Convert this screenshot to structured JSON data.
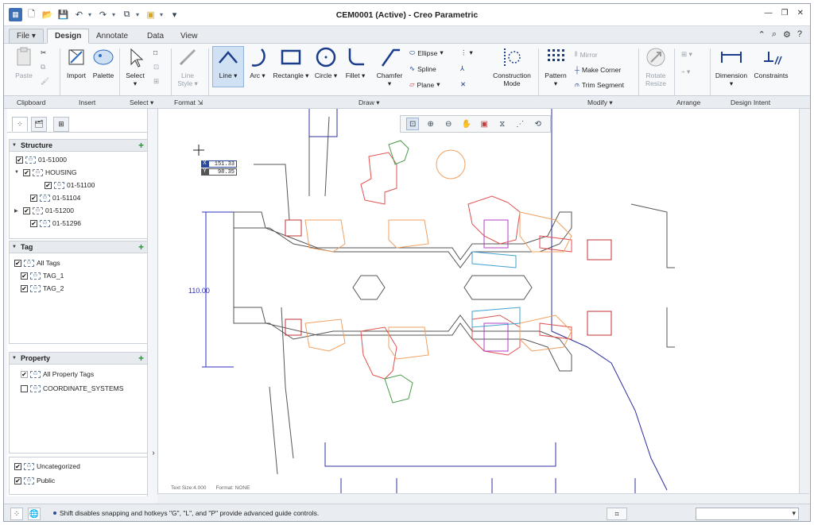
{
  "app": {
    "title": "CEM0001 (Active) - Creo Parametric"
  },
  "quick_access": {
    "icons": [
      "new-icon",
      "open-icon",
      "save-icon",
      "undo-icon",
      "redo-icon",
      "regenerate-icon",
      "windows-icon",
      "customize-icon"
    ]
  },
  "tabs": [
    {
      "label": "File"
    },
    {
      "label": "Design"
    },
    {
      "label": "Annotate"
    },
    {
      "label": "Data"
    },
    {
      "label": "View"
    }
  ],
  "ribbon": {
    "paste": "Paste",
    "import": "Import",
    "palette": "Palette",
    "select": "Select",
    "line_style": "Line",
    "line_style2": "Style",
    "line": "Line",
    "arc": "Arc",
    "rectangle": "Rectangle",
    "circle": "Circle",
    "fillet": "Fillet",
    "chamfer": "Chamfer",
    "ellipse": "Ellipse",
    "spline": "Spline",
    "plane": "Plane",
    "construction_mode": "Construction",
    "construction_mode2": "Mode",
    "pattern": "Pattern",
    "mirror": "Mirror",
    "make_corner": "Make Corner",
    "trim_segment": "Trim Segment",
    "rotate_resize": "Rotate",
    "rotate_resize2": "Resize",
    "dimension": "Dimension",
    "constraints": "Constraints"
  },
  "groups": {
    "clipboard": "Clipboard",
    "insert": "Insert",
    "select": "Select",
    "format": "Format",
    "draw": "Draw",
    "modify": "Modify",
    "arrange": "Arrange",
    "design_intent": "Design Intent"
  },
  "panel": {
    "structure": {
      "title": "Structure",
      "items": [
        {
          "label": "01-51000"
        },
        {
          "label": "HOUSING"
        },
        {
          "label": "01-51100"
        },
        {
          "label": "01-51104"
        },
        {
          "label": "01-51200"
        },
        {
          "label": "01-51296"
        }
      ]
    },
    "tag": {
      "title": "Tag",
      "items": [
        {
          "label": "All Tags"
        },
        {
          "label": "TAG_1"
        },
        {
          "label": "TAG_2"
        }
      ]
    },
    "property": {
      "title": "Property",
      "items": [
        {
          "label": "All Property Tags"
        },
        {
          "label": "COORDINATE_SYSTEMS"
        }
      ]
    },
    "bottom": {
      "items": [
        {
          "label": "Uncategorized"
        },
        {
          "label": "Public"
        }
      ]
    }
  },
  "canvas": {
    "coord_x_label": "X",
    "coord_x": "151.33",
    "coord_y_label": "Y",
    "coord_y": "98.35",
    "dimension": "110.00",
    "text_size": "Text Size:4.000",
    "format": "Format: NONE",
    "colors": {
      "orange": "#f0a060",
      "red": "#e05050",
      "green": "#4a9a4a",
      "purple": "#b040c0",
      "blue": "#3030a0",
      "gray": "#555555",
      "cyan": "#40a0d0"
    }
  },
  "status": {
    "message": "Shift disables snapping and hotkeys \"G\", \"L\", and \"P\" provide advanced guide controls."
  }
}
